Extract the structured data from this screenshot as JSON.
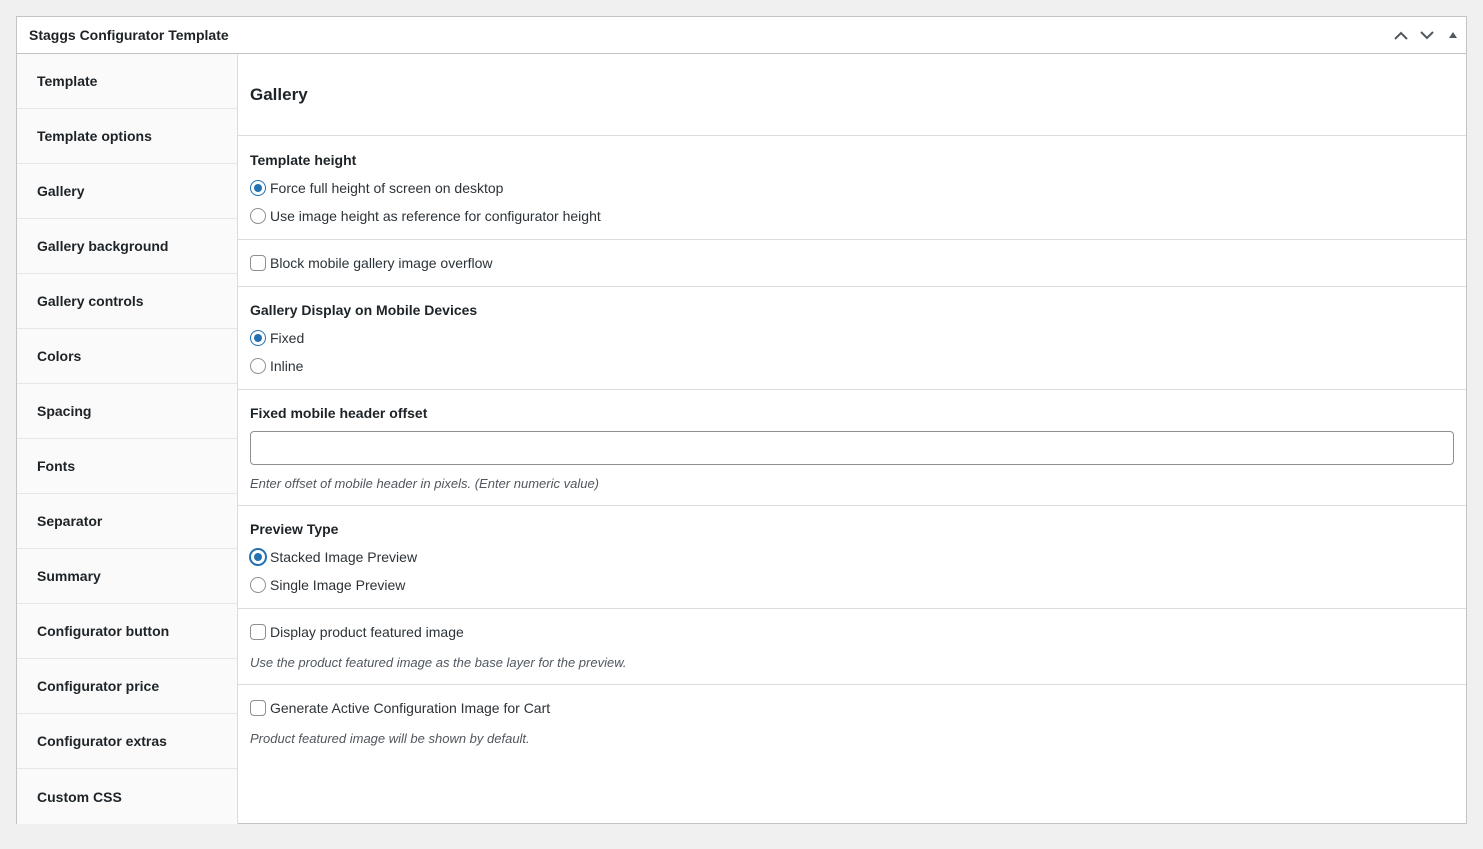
{
  "postbox": {
    "title": "Staggs Configurator Template",
    "actions": [
      "chevron-up-icon",
      "chevron-down-icon",
      "triangle-up-icon"
    ]
  },
  "tabs": [
    {
      "label": "Template"
    },
    {
      "label": "Template options"
    },
    {
      "label": "Gallery"
    },
    {
      "label": "Gallery background"
    },
    {
      "label": "Gallery controls"
    },
    {
      "label": "Colors"
    },
    {
      "label": "Spacing"
    },
    {
      "label": "Fonts"
    },
    {
      "label": "Separator"
    },
    {
      "label": "Summary"
    },
    {
      "label": "Configurator button"
    },
    {
      "label": "Configurator price"
    },
    {
      "label": "Configurator extras"
    },
    {
      "label": "Custom CSS"
    }
  ],
  "panel": {
    "title": "Gallery",
    "template_height": {
      "label": "Template height",
      "options": [
        "Force full height of screen on desktop",
        "Use image height as reference for configurator height"
      ],
      "selected": "Force full height of screen on desktop"
    },
    "block_overflow": {
      "label": "Block mobile gallery image overflow",
      "checked": false
    },
    "mobile_display": {
      "label": "Gallery Display on Mobile Devices",
      "options": [
        "Fixed",
        "Inline"
      ],
      "selected": "Fixed"
    },
    "header_offset": {
      "label": "Fixed mobile header offset",
      "value": "",
      "description": "Enter offset of mobile header in pixels. (Enter numeric value)"
    },
    "preview_type": {
      "label": "Preview Type",
      "options": [
        "Stacked Image Preview",
        "Single Image Preview"
      ],
      "selected": "Stacked Image Preview"
    },
    "featured_image": {
      "label": "Display product featured image",
      "checked": false,
      "description": "Use the product featured image as the base layer for the preview."
    },
    "cart_image": {
      "label": "Generate Active Configuration Image for Cart",
      "checked": false,
      "description": "Product featured image will be shown by default."
    }
  },
  "colors": {
    "accent": "#2271b1",
    "border": "#c3c4c7",
    "background": "#f0f0f1"
  }
}
